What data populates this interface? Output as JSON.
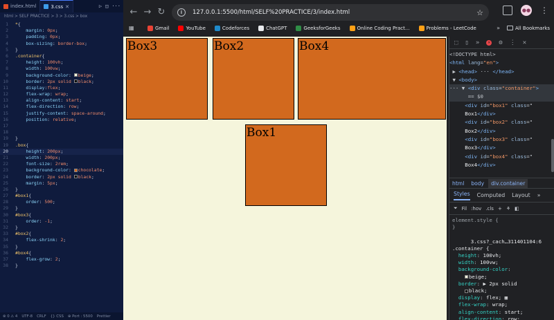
{
  "editor": {
    "tabs": [
      {
        "label": "index.html",
        "active": false
      },
      {
        "label": "3.css",
        "active": true
      }
    ],
    "breadcrumb": "html > SELF PRACTICE > 3 > 3.css > box",
    "lines": [
      {
        "n": "1",
        "html": "<span class='sel'>*</span><span class='pun'>{</span>"
      },
      {
        "n": "2",
        "html": "    <span class='prop'>margin</span><span class='pun'>:</span> <span class='val'>0px</span><span class='pun'>;</span>"
      },
      {
        "n": "3",
        "html": "    <span class='prop'>padding</span><span class='pun'>:</span> <span class='val'>0px</span><span class='pun'>;</span>"
      },
      {
        "n": "4",
        "html": "    <span class='prop'>box-sizing</span><span class='pun'>:</span> <span class='val'>border-box</span><span class='pun'>;</span>"
      },
      {
        "n": "5",
        "html": "<span class='pun'>}</span>"
      },
      {
        "n": "6",
        "html": "<span class='sel'>.container</span><span class='pun'>{</span>"
      },
      {
        "n": "7",
        "html": "    <span class='prop'>height</span><span class='pun'>:</span> <span class='val'>100vh</span><span class='pun'>;</span>"
      },
      {
        "n": "8",
        "html": "    <span class='prop'>width</span><span class='pun'>:</span> <span class='val'>100vw</span><span class='pun'>;</span>"
      },
      {
        "n": "9",
        "html": "    <span class='prop'>background-color</span><span class='pun'>:</span> <span class='sw' style='background:#f5f5dc'></span><span class='val'>beige</span><span class='pun'>;</span>"
      },
      {
        "n": "10",
        "html": "    <span class='prop'>border</span><span class='pun'>:</span> <span class='val'>2px solid</span> <span class='sw' style='background:#000'></span><span class='val'>black</span><span class='pun'>;</span>"
      },
      {
        "n": "11",
        "html": "    <span class='prop'>display</span><span class='pun'>:</span><span class='val'>flex</span><span class='pun'>;</span>"
      },
      {
        "n": "12",
        "html": "    <span class='prop'>flex-wrap</span><span class='pun'>:</span> <span class='val'>wrap</span><span class='pun'>;</span>"
      },
      {
        "n": "13",
        "html": "    <span class='prop'>align-content</span><span class='pun'>:</span> <span class='val'>start</span><span class='pun'>;</span>"
      },
      {
        "n": "14",
        "html": "    <span class='prop'>flex-direction</span><span class='pun'>:</span> <span class='val'>row</span><span class='pun'>;</span>"
      },
      {
        "n": "15",
        "html": "    <span class='prop'>justify-content</span><span class='pun'>:</span> <span class='val'>space-around</span><span class='pun'>;</span>"
      },
      {
        "n": "16",
        "html": "    <span class='prop'>position</span><span class='pun'>:</span> <span class='val'>relative</span><span class='pun'>;</span>"
      },
      {
        "n": "17",
        "html": ""
      },
      {
        "n": "18",
        "html": ""
      },
      {
        "n": "19",
        "html": "<span class='pun'>}</span>"
      },
      {
        "n": "19",
        "html": "<span class='sel'>.box</span><span class='pun'>{</span>"
      },
      {
        "n": "20",
        "html": "    <span class='prop'>height</span><span class='pun'>:</span> <span class='val'>200px</span><span class='pun'>;</span>",
        "current": true
      },
      {
        "n": "21",
        "html": "    <span class='prop'>width</span><span class='pun'>:</span> <span class='val'>200px</span><span class='pun'>;</span>"
      },
      {
        "n": "22",
        "html": "    <span class='prop'>font-size</span><span class='pun'>:</span> <span class='val'>2rem</span><span class='pun'>;</span>"
      },
      {
        "n": "23",
        "html": "    <span class='prop'>background-color</span><span class='pun'>:</span> <span class='sw' style='background:#d2691e'></span><span class='val'>chocolate</span><span class='pun'>;</span>"
      },
      {
        "n": "24",
        "html": "    <span class='prop'>border</span><span class='pun'>:</span> <span class='val'>2px solid</span> <span class='sw' style='background:#000'></span><span class='val'>black</span><span class='pun'>;</span>"
      },
      {
        "n": "25",
        "html": "    <span class='prop'>margin</span><span class='pun'>:</span> <span class='val'>5px</span><span class='pun'>;</span>"
      },
      {
        "n": "26",
        "html": "<span class='pun'>}</span>"
      },
      {
        "n": "27",
        "html": "<span class='sel'>#box1</span><span class='pun'>{</span>"
      },
      {
        "n": "28",
        "html": "    <span class='prop'>order</span><span class='pun'>:</span> <span class='val'>500</span><span class='pun'>;</span>"
      },
      {
        "n": "29",
        "html": "<span class='pun'>}</span>"
      },
      {
        "n": "30",
        "html": "<span class='sel'>#box3</span><span class='pun'>{</span>"
      },
      {
        "n": "31",
        "html": "    <span class='prop'>order</span><span class='pun'>:</span> <span class='val'>-1</span><span class='pun'>;</span>"
      },
      {
        "n": "32",
        "html": "<span class='pun'>}</span>"
      },
      {
        "n": "33",
        "html": "<span class='sel'>#box2</span><span class='pun'>{</span>"
      },
      {
        "n": "34",
        "html": "    <span class='prop'>flex-shrink</span><span class='pun'>:</span> <span class='val'>2</span><span class='pun'>;</span>"
      },
      {
        "n": "35",
        "html": "<span class='pun'>}</span>"
      },
      {
        "n": "36",
        "html": "<span class='sel'>#box4</span><span class='pun'>{</span>"
      },
      {
        "n": "37",
        "html": "    <span class='prop'>flex-grow</span><span class='pun'>:</span> <span class='val'>2</span><span class='pun'>;</span>"
      },
      {
        "n": "38",
        "html": "<span class='pun'>}</span>"
      }
    ],
    "status": [
      "⊗ 0  ⚠ 4",
      "UTF-8",
      "CRLF",
      "{} CSS",
      "⊕ Port : 5500",
      "Prettier"
    ]
  },
  "browser": {
    "url": "127.0.0.1:5500/html/SELF%20PRACTICE/3/index.html",
    "bookmarks": [
      {
        "label": "Gmail",
        "color": "#ea4335"
      },
      {
        "label": "YouTube",
        "color": "#ff0000"
      },
      {
        "label": "Codeforces",
        "color": "#1f8acb"
      },
      {
        "label": "ChatGPT",
        "color": "#e8eaed"
      },
      {
        "label": "GeeksforGeeks",
        "color": "#2f8d46"
      },
      {
        "label": "Online Coding Pract...",
        "color": "#ffa116"
      },
      {
        "label": "Problems - LeetCode",
        "color": "#ffa116"
      }
    ],
    "all_bookmarks": "All Bookmarks",
    "page_bg": "#f5f5dc",
    "box_color": "#d2691e",
    "boxes": [
      "Box3",
      "Box2",
      "Box4",
      "Box1"
    ]
  },
  "devtools": {
    "dom_lines": [
      "<span class='dim'>&lt;!DOCTYPE html&gt;</span>",
      "<span class='tag'>&lt;html</span> <span class='attr'>lang</span>=<span class='aval'>\"en\"</span><span class='tag'>&gt;</span>",
      "&nbsp;▶ <span class='tag'>&lt;head&gt;</span> ··· <span class='tag'>&lt;/head&gt;</span>",
      "&nbsp;▼ <span class='tag'>&lt;body&gt;</span>",
      "··· ▼ <span class='tag'>&lt;div</span> <span class='attr'>class</span>=<span class='aval'>\"container\"</span><span class='tag'>&gt;</span>",
      "&nbsp;&nbsp;&nbsp;&nbsp;&nbsp;&nbsp;== $0",
      "&nbsp;&nbsp;&nbsp;&nbsp;&nbsp;<span class='tag'>&lt;div</span> <span class='attr'>id</span>=<span class='aval'>\"box1\"</span> <span class='attr'>class</span>=\"",
      "&nbsp;&nbsp;&nbsp;&nbsp;&nbsp;<span class='txt'>Box1</span><span class='tag'>&lt;/div&gt;</span>",
      "&nbsp;&nbsp;&nbsp;&nbsp;&nbsp;<span class='tag'>&lt;div</span> <span class='attr'>id</span>=<span class='aval'>\"box2\"</span> <span class='attr'>class</span>=\"",
      "&nbsp;&nbsp;&nbsp;&nbsp;&nbsp;<span class='txt'>Box2</span><span class='tag'>&lt;/div&gt;</span>",
      "&nbsp;&nbsp;&nbsp;&nbsp;&nbsp;<span class='tag'>&lt;div</span> <span class='attr'>id</span>=<span class='aval'>\"box3\"</span> <span class='attr'>class</span>=\"",
      "&nbsp;&nbsp;&nbsp;&nbsp;&nbsp;<span class='txt'>Box3</span><span class='tag'>&lt;/div&gt;</span>",
      "&nbsp;&nbsp;&nbsp;&nbsp;&nbsp;<span class='tag'>&lt;div</span> <span class='attr'>id</span>=<span class='aval'>\"box4\"</span> <span class='attr'>class</span>=\"",
      "&nbsp;&nbsp;&nbsp;&nbsp;&nbsp;<span class='txt'>Box4</span><span class='tag'>&lt;/div&gt;</span>"
    ],
    "crumbs": [
      "html",
      "body",
      "div.container"
    ],
    "panel_tabs": [
      "Styles",
      "Computed",
      "Layout"
    ],
    "filter_label": "Fil",
    "hov_label": ":hov",
    "cls_label": ".cls",
    "style_lines": [
      "<span class='dim'>element.style {</span>",
      "<span class='dim'>}</span>",
      "",
      "&nbsp;&nbsp;&nbsp;&nbsp;&nbsp;&nbsp;<span class='v'>3.css?_cach…311401104:6</span>",
      "<span class='v'>.container {</span>",
      "&nbsp;&nbsp;<span class='p'>height</span>: <span class='v'>100vh;</span>",
      "&nbsp;&nbsp;<span class='p'>width</span>: <span class='v'>100vw;</span>",
      "&nbsp;&nbsp;<span class='p'>background-color</span>:",
      "&nbsp;&nbsp;&nbsp;&nbsp;<span class='sw' style='background:#f5f5dc'></span><span class='v'>beige;</span>",
      "&nbsp;&nbsp;<span class='p'>border</span>: <span class='v'>▶ 2px solid</span>",
      "&nbsp;&nbsp;&nbsp;&nbsp;<span class='sw' style='background:#000'></span><span class='v'>black;</span>",
      "&nbsp;&nbsp;<span class='p'>display</span>: <span class='v'>flex;</span> <span class='v'>▦</span>",
      "&nbsp;&nbsp;<span class='p'>flex-wrap</span>: <span class='v'>wrap;</span>",
      "&nbsp;&nbsp;<span class='p'>align-content</span>: <span class='v'>start;</span>",
      "&nbsp;&nbsp;<span class='p'>flex-direction</span>: <span class='v'>row;</span>"
    ]
  }
}
